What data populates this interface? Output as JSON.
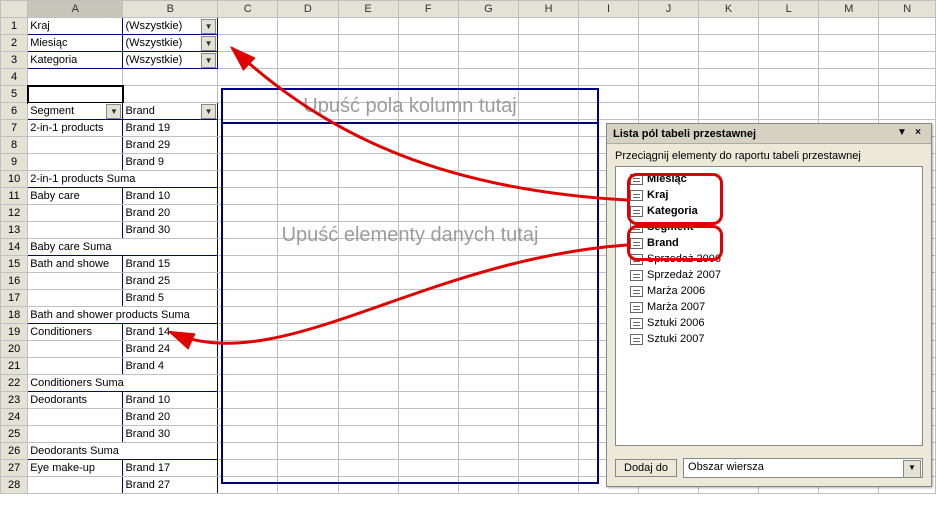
{
  "columns": [
    "A",
    "B",
    "C",
    "D",
    "E",
    "F",
    "G",
    "H",
    "I",
    "J",
    "K",
    "L",
    "M",
    "N"
  ],
  "filters": [
    {
      "row": 1,
      "label": "Kraj",
      "value": "(Wszystkie)"
    },
    {
      "row": 2,
      "label": "Miesiąc",
      "value": "(Wszystkie)"
    },
    {
      "row": 3,
      "label": "Kategoria",
      "value": "(Wszystkie)"
    }
  ],
  "pivot_head": {
    "row": 6,
    "a": "Segment",
    "b": "Brand"
  },
  "data_rows": [
    {
      "row": 7,
      "a": "2-in-1 products",
      "b": "Brand 19"
    },
    {
      "row": 8,
      "a": "",
      "b": "Brand 29"
    },
    {
      "row": 9,
      "a": "",
      "b": "Brand 9"
    },
    {
      "row": 10,
      "a": "2-in-1 products Suma",
      "b": "",
      "sum": true
    },
    {
      "row": 11,
      "a": "Baby care",
      "b": "Brand 10"
    },
    {
      "row": 12,
      "a": "",
      "b": "Brand 20"
    },
    {
      "row": 13,
      "a": "",
      "b": "Brand 30"
    },
    {
      "row": 14,
      "a": "Baby care Suma",
      "b": "",
      "sum": true
    },
    {
      "row": 15,
      "a": "Bath and showe",
      "b": "Brand 15"
    },
    {
      "row": 16,
      "a": "",
      "b": "Brand 25"
    },
    {
      "row": 17,
      "a": "",
      "b": "Brand 5"
    },
    {
      "row": 18,
      "a": "Bath and shower products Suma",
      "b": "",
      "sum": true,
      "span": true
    },
    {
      "row": 19,
      "a": "Conditioners",
      "b": "Brand 14"
    },
    {
      "row": 20,
      "a": "",
      "b": "Brand 24"
    },
    {
      "row": 21,
      "a": "",
      "b": "Brand 4"
    },
    {
      "row": 22,
      "a": "Conditioners Suma",
      "b": "",
      "sum": true
    },
    {
      "row": 23,
      "a": "Deodorants",
      "b": "Brand 10"
    },
    {
      "row": 24,
      "a": "",
      "b": "Brand 20"
    },
    {
      "row": 25,
      "a": "",
      "b": "Brand 30"
    },
    {
      "row": 26,
      "a": "Deodorants Suma",
      "b": "",
      "sum": true
    },
    {
      "row": 27,
      "a": "Eye make-up",
      "b": "Brand 17"
    },
    {
      "row": 28,
      "a": "",
      "b": "Brand 27"
    }
  ],
  "drop_cols_text": "Upuść pola kolumn tutaj",
  "drop_data_text": "Upuść elementy danych tutaj",
  "fieldlist": {
    "title": "Lista pól tabeli przestawnej",
    "subtitle": "Przeciągnij elementy do raportu tabeli przestawnej",
    "items": [
      {
        "label": "Miesiąc",
        "bold": true
      },
      {
        "label": "Kraj",
        "bold": true
      },
      {
        "label": "Kategoria",
        "bold": true
      },
      {
        "label": "Segment",
        "bold": true
      },
      {
        "label": "Brand",
        "bold": true
      },
      {
        "label": "Sprzedaż 2006",
        "bold": false
      },
      {
        "label": "Sprzedaż 2007",
        "bold": false
      },
      {
        "label": "Marża 2006",
        "bold": false
      },
      {
        "label": "Marża 2007",
        "bold": false
      },
      {
        "label": "Sztuki 2006",
        "bold": false
      },
      {
        "label": "Sztuki 2007",
        "bold": false
      }
    ],
    "add_button": "Dodaj do",
    "combo_value": "Obszar wiersza"
  }
}
